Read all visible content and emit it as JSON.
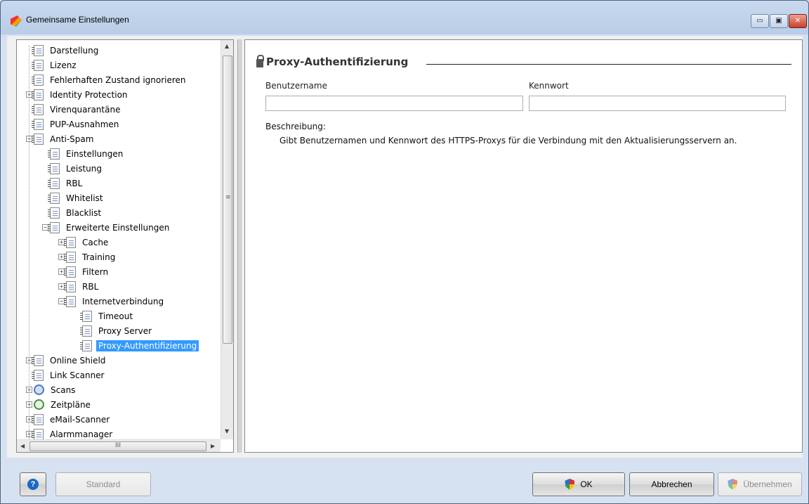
{
  "window": {
    "title": "Gemeinsame Einstellungen",
    "controls": {
      "minimize": "▭",
      "maximize": "▣",
      "close": "✕"
    }
  },
  "tree": {
    "items": [
      {
        "label": "Darstellung",
        "level": 0,
        "expander": "",
        "icon": "doc-icon"
      },
      {
        "label": "Lizenz",
        "level": 0,
        "expander": "",
        "icon": "doc-icon"
      },
      {
        "label": "Fehlerhaften Zustand ignorieren",
        "level": 0,
        "expander": "",
        "icon": "doc-icon"
      },
      {
        "label": "Identity Protection",
        "level": 0,
        "expander": "+",
        "icon": "doc-icon"
      },
      {
        "label": "Virenquarantäne",
        "level": 0,
        "expander": "",
        "icon": "doc-icon"
      },
      {
        "label": "PUP-Ausnahmen",
        "level": 0,
        "expander": "",
        "icon": "doc-icon"
      },
      {
        "label": "Anti-Spam",
        "level": 0,
        "expander": "−",
        "icon": "doc-icon"
      },
      {
        "label": "Einstellungen",
        "level": 1,
        "expander": "",
        "icon": "doc-icon"
      },
      {
        "label": "Leistung",
        "level": 1,
        "expander": "",
        "icon": "doc-icon"
      },
      {
        "label": "RBL",
        "level": 1,
        "expander": "",
        "icon": "doc-icon"
      },
      {
        "label": "Whitelist",
        "level": 1,
        "expander": "",
        "icon": "doc-icon"
      },
      {
        "label": "Blacklist",
        "level": 1,
        "expander": "",
        "icon": "doc-icon"
      },
      {
        "label": "Erweiterte Einstellungen",
        "level": 1,
        "expander": "−",
        "icon": "doc-icon"
      },
      {
        "label": "Cache",
        "level": 2,
        "expander": "+",
        "icon": "doc-icon"
      },
      {
        "label": "Training",
        "level": 2,
        "expander": "+",
        "icon": "doc-icon"
      },
      {
        "label": "Filtern",
        "level": 2,
        "expander": "+",
        "icon": "doc-icon"
      },
      {
        "label": "RBL",
        "level": 2,
        "expander": "+",
        "icon": "doc-icon"
      },
      {
        "label": "Internetverbindung",
        "level": 2,
        "expander": "−",
        "icon": "doc-icon"
      },
      {
        "label": "Timeout",
        "level": 3,
        "expander": "",
        "icon": "doc-icon"
      },
      {
        "label": "Proxy Server",
        "level": 3,
        "expander": "",
        "icon": "doc-icon"
      },
      {
        "label": "Proxy-Authentifizierung",
        "level": 3,
        "expander": "",
        "icon": "doc-icon",
        "selected": true
      },
      {
        "label": "Online Shield",
        "level": 0,
        "expander": "+",
        "icon": "doc-icon"
      },
      {
        "label": "Link Scanner",
        "level": 0,
        "expander": "",
        "icon": "doc-icon"
      },
      {
        "label": "Scans",
        "level": 0,
        "expander": "+",
        "icon": "scan-icon"
      },
      {
        "label": "Zeitpläne",
        "level": 0,
        "expander": "+",
        "icon": "clock-icon"
      },
      {
        "label": "eMail-Scanner",
        "level": 0,
        "expander": "+",
        "icon": "doc-icon"
      },
      {
        "label": "Alarmmanager",
        "level": 0,
        "expander": "+",
        "icon": "doc-icon"
      }
    ],
    "scrollbar": {
      "up": "▲",
      "down": "▼",
      "left": "◀",
      "right": "▶",
      "grip": "≡",
      "hgrip": "III"
    }
  },
  "content": {
    "section_title": "Proxy-Authentifizierung",
    "username_label": "Benutzername",
    "password_label": "Kennwort",
    "username_value": "",
    "password_value": "",
    "description_label": "Beschreibung:",
    "description_text": "Gibt Benutzernamen und Kennwort des HTTPS-Proxys für die Verbindung mit den Aktualisierungsservern an."
  },
  "buttons": {
    "help": "?",
    "standard": "Standard",
    "ok": "OK",
    "cancel": "Abbrechen",
    "apply": "Übernehmen"
  },
  "colors": {
    "selection": "#3399ff",
    "titlebar": "#b9cde7"
  }
}
